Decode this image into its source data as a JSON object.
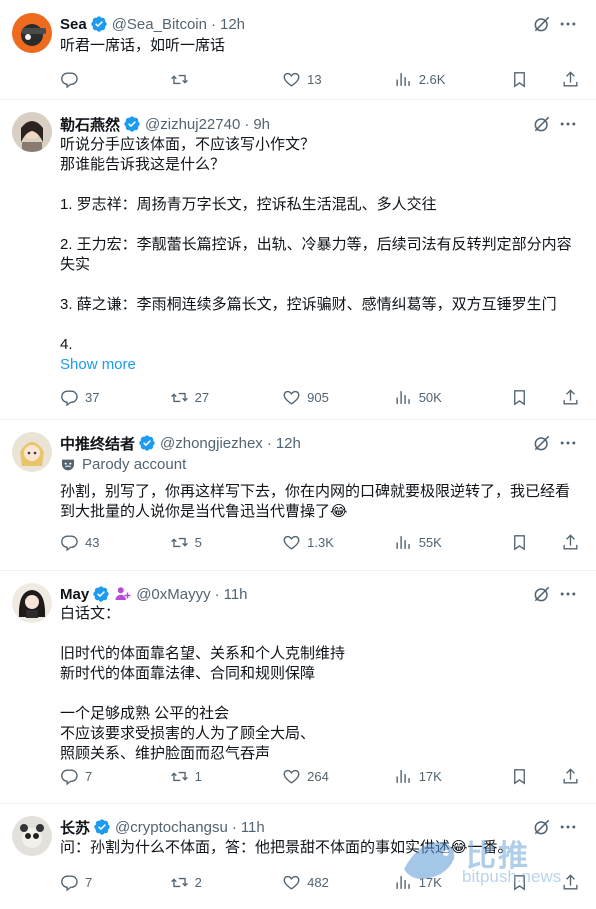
{
  "tweets": [
    {
      "name": "Sea",
      "handle": "@Sea_Bitcoin",
      "time": "12h",
      "text": "听君一席话，如听一席话",
      "stats": {
        "replies": "",
        "retweets": "",
        "likes": "13",
        "views": "2.6K"
      }
    },
    {
      "name": "勒石燕然",
      "handle": "@zizhuj22740",
      "time": "9h",
      "text": "听说分手应该体面，不应该写小作文？\n那谁能告诉我这是什么？\n\n1. 罗志祥：周扬青万字长文，控诉私生活混乱、多人交往\n\n2. 王力宏：李靓蕾长篇控诉，出轨、冷暴力等，后续司法有反转判定部分内容\n失实\n\n3. 薛之谦：李雨桐连续多篇长文，控诉骗财、感情纠葛等，双方互锤罗生门\n\n4.",
      "show_more": "Show more",
      "stats": {
        "replies": "37",
        "retweets": "27",
        "likes": "905",
        "views": "50K"
      }
    },
    {
      "name": "中推终结者",
      "handle": "@zhongjiezhex",
      "time": "12h",
      "label": "Parody account",
      "text": "孙割，别写了，你再这样写下去，你在内网的口碑就要极限逆转了，我已经看\n到大批量的人说你是当代鲁迅当代曹操了😂",
      "stats": {
        "replies": "43",
        "retweets": "5",
        "likes": "1.3K",
        "views": "55K"
      }
    },
    {
      "name": "May",
      "handle": "@0xMayyy",
      "time": "11h",
      "text": "白话文：\n\n旧时代的体面靠名望、关系和个人克制维持\n新时代的体面靠法律、合同和规则保障\n\n一个足够成熟 公平的社会\n不应该要求受损害的人为了顾全大局、\n照顾关系、维护脸面而忍气吞声",
      "stats": {
        "replies": "7",
        "retweets": "1",
        "likes": "264",
        "views": "17K"
      }
    },
    {
      "name": "长苏",
      "handle": "@cryptochangsu",
      "time": "11h",
      "text": "问：孙割为什么不体面，答：他把景甜不体面的事如实供述😂一番。",
      "stats": {
        "replies": "7",
        "retweets": "2",
        "likes": "482",
        "views": "17K"
      }
    }
  ],
  "watermark": {
    "cn": "比推",
    "en": "bitpush.news"
  },
  "colors": {
    "accent": "#1d9bf0",
    "muted": "#536471",
    "text": "#0f1419",
    "divider": "#eff3f4"
  },
  "icons": [
    "verified-badge-icon",
    "grok-icon",
    "more-icon",
    "reply-icon",
    "retweet-icon",
    "like-icon",
    "views-icon",
    "bookmark-icon",
    "share-icon",
    "parody-mask-icon",
    "affiliate-icon"
  ]
}
